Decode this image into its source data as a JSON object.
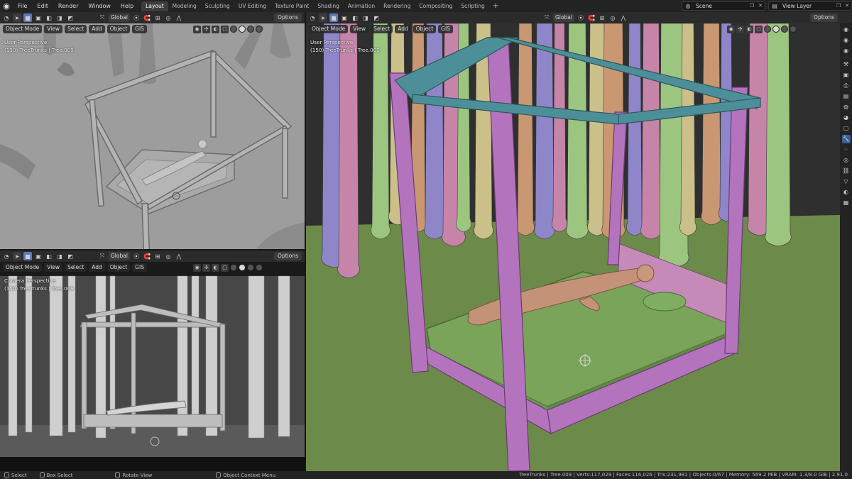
{
  "topbar": {
    "menus": [
      "File",
      "Edit",
      "Render",
      "Window",
      "Help"
    ],
    "tabs": [
      "Layout",
      "Modeling",
      "Sculpting",
      "UV Editing",
      "Texture Paint",
      "Shading",
      "Animation",
      "Rendering",
      "Compositing",
      "Scripting"
    ],
    "active_tab": "Layout",
    "scene": "Scene",
    "view_layer": "View Layer"
  },
  "header": {
    "orientation": "Global",
    "options": "Options",
    "mode": "Object Mode",
    "view": "View",
    "select": "Select",
    "add": "Add",
    "object": "Object",
    "gis": "GIS"
  },
  "viewports": {
    "top_left": {
      "perspective": "User Perspective",
      "info": "(150) TreeTrunks | Tree.009"
    },
    "bottom_left": {
      "perspective": "Camera Perspective",
      "info": "(150) TreeTrunks | Tree.009"
    },
    "main": {
      "perspective": "User Perspective",
      "info": "(150) TreeTrunks | Tree.009"
    }
  },
  "statusbar": {
    "select": "Select",
    "box_select": "Box Select",
    "rotate": "Rotate View",
    "context": "Object Context Menu",
    "stats": "TreeTrunks | Tree.009 | Verts:117,029 | Faces:116,026 | Tris:231,981 | Objects:0/67 | Memory: 569.2 MiB | VRAM: 1.3/8.0 GiB | 2.91.0"
  },
  "colors": {
    "accent": "#5a79b8",
    "tree_purple": "#8e86c9",
    "tree_pink": "#c685a8",
    "tree_green": "#9cc67f",
    "tree_yellow": "#cbc08a",
    "tree_orange": "#c99772",
    "ground": "#6c8a4a",
    "bed_frame": "#b374bd",
    "canopy": "#4d8f98",
    "mattress": "#79a45a"
  }
}
